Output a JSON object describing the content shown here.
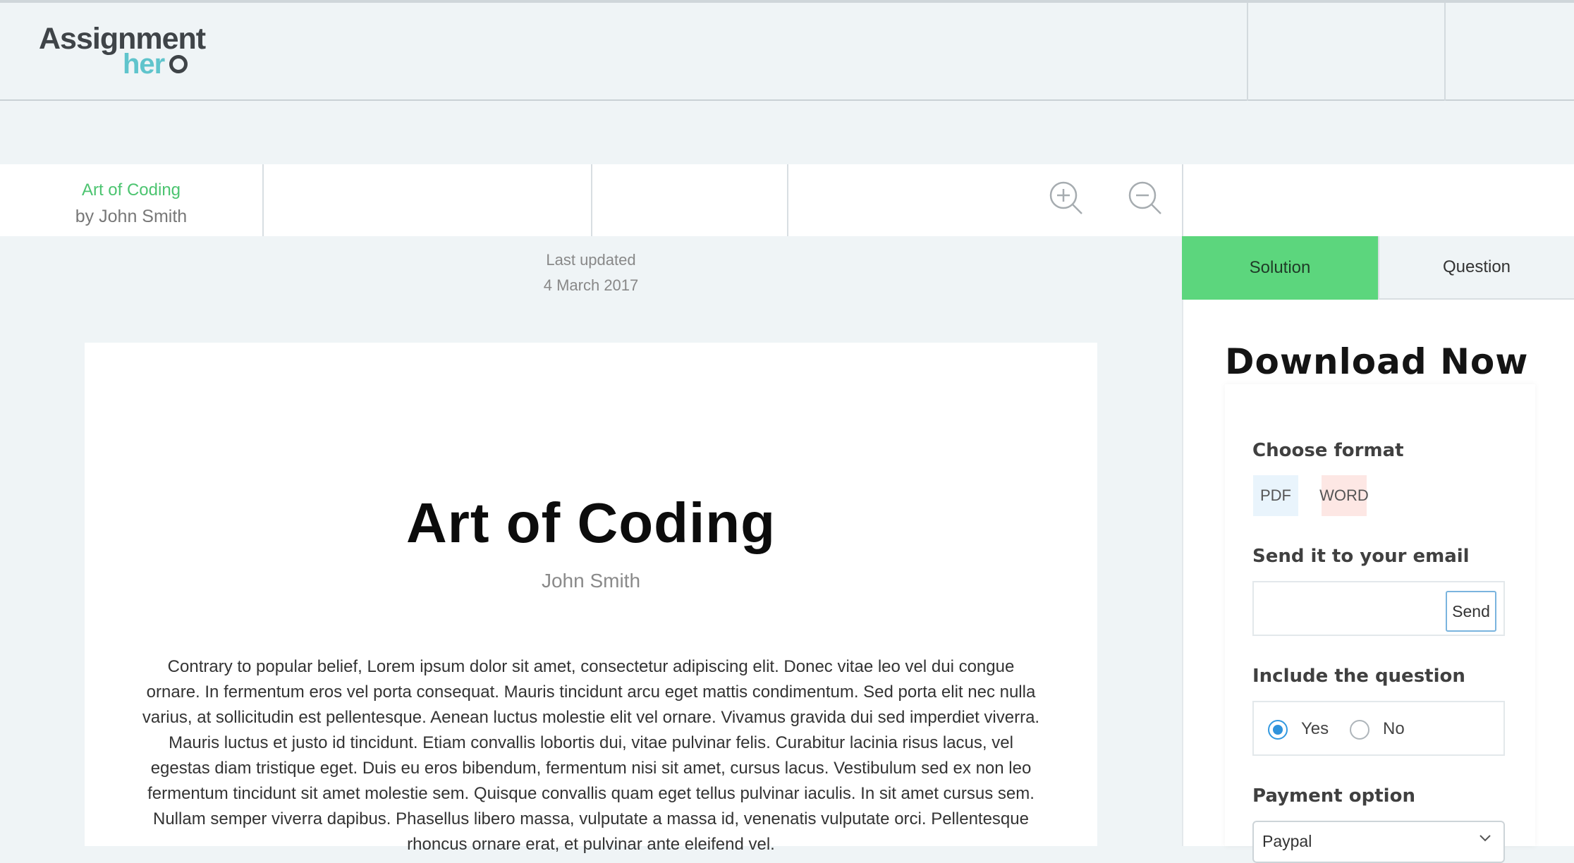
{
  "header": {
    "logo_top": "Assignment",
    "logo_bottom": "her"
  },
  "toolbar": {
    "doc_title": "Art of Coding",
    "doc_author": "by John Smith",
    "zoom_in_icon": "zoom-in-icon",
    "zoom_out_icon": "zoom-out-icon"
  },
  "meta": {
    "last_updated_label": "Last updated",
    "last_updated_date": "4 March 2017"
  },
  "document": {
    "title": "Art of Coding",
    "author": "John Smith",
    "body": "Contrary to popular belief, Lorem ipsum dolor sit amet, consectetur adipiscing elit. Donec vitae leo vel dui congue ornare. In fermentum eros vel porta consequat. Mauris tincidunt arcu eget mattis condimentum. Sed porta elit nec nulla varius, at sollicitudin est pellentesque. Aenean luctus molestie elit vel ornare. Vivamus gravida dui sed imperdiet viverra. Mauris luctus et justo id tincidunt. Etiam convallis lobortis dui, vitae pulvinar felis. Curabitur lacinia risus lacus, vel egestas diam tristique eget. Duis eu eros bibendum, fermentum nisi sit amet, cursus lacus. Vestibulum sed ex non leo fermentum tincidunt sit amet molestie sem. Quisque convallis quam eget tellus pulvinar iaculis. In sit amet cursus sem. Nullam semper viverra dapibus. Phasellus libero massa, vulputate a massa id, venenatis vulputate orci. Pellentesque rhoncus ornare erat, et pulvinar ante eleifend vel."
  },
  "panel": {
    "tabs": [
      {
        "label": "Solution",
        "active": true
      },
      {
        "label": "Question",
        "active": false
      }
    ],
    "download_title": "Download Now",
    "choose_format_label": "Choose format",
    "formats": [
      "PDF",
      "WORD"
    ],
    "email_label": "Send it to your email",
    "email_value": "",
    "send_label": "Send",
    "include_question_label": "Include the question",
    "include_options": [
      {
        "label": "Yes",
        "selected": true
      },
      {
        "label": "No",
        "selected": false
      }
    ],
    "payment_label": "Payment option",
    "payment_selected": "Paypal"
  },
  "colors": {
    "accent_green": "#5cd67d",
    "title_green": "#4cc470",
    "logo_teal": "#5fc4cc",
    "radio_blue": "#2f93dc",
    "background": "#eff4f6"
  }
}
